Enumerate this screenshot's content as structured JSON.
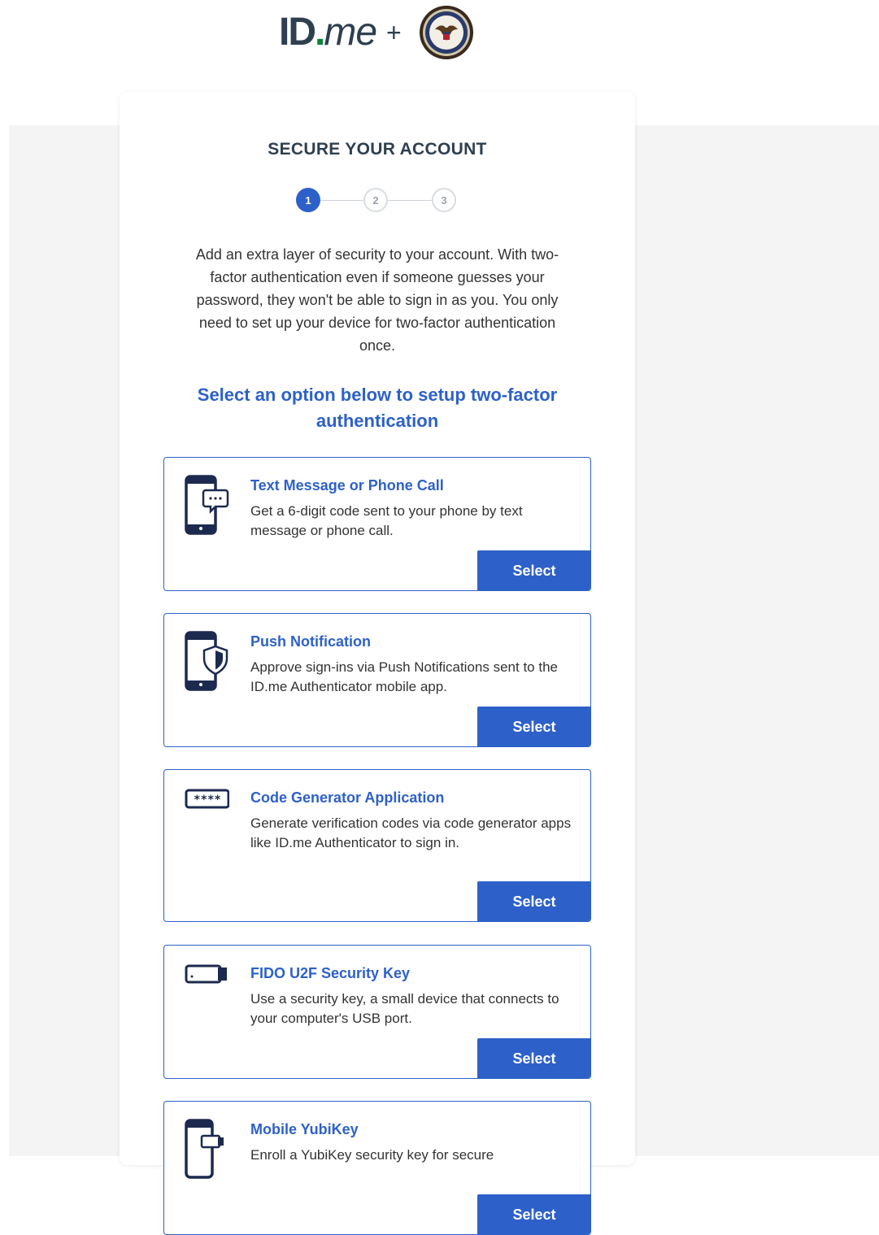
{
  "header": {
    "logo_id": "ID",
    "logo_dot": ".",
    "logo_me": "me",
    "plus": "+"
  },
  "card": {
    "title": "SECURE YOUR ACCOUNT",
    "steps": [
      "1",
      "2",
      "3"
    ],
    "active_step": 1,
    "intro": "Add an extra layer of security to your account. With two-factor authentication even if someone guesses your password, they won't be able to sign in as you. You only need to set up your device for two-factor authentication once.",
    "subhead": "Select an option below to setup two-factor authentication"
  },
  "options": [
    {
      "icon": "phone-message-icon",
      "title": "Text Message or Phone Call",
      "description": "Get a 6-digit code sent to your phone by text message or phone call.",
      "button": "Select"
    },
    {
      "icon": "phone-shield-icon",
      "title": "Push Notification",
      "description": "Approve sign-ins via Push Notifications sent to the ID.me Authenticator mobile app.",
      "button": "Select"
    },
    {
      "icon": "password-code-icon",
      "title": "Code Generator Application",
      "description": "Generate verification codes via code generator apps like ID.me Authenticator to sign in.",
      "button": "Select"
    },
    {
      "icon": "usb-key-icon",
      "title": "FIDO U2F Security Key",
      "description": "Use a security key, a small device that connects to your computer's USB port.",
      "button": "Select"
    },
    {
      "icon": "phone-usb-key-icon",
      "title": "Mobile YubiKey",
      "description": "Enroll a YubiKey security key for secure",
      "button": "Select"
    }
  ],
  "colors": {
    "accent": "#2d61c9",
    "logo_text": "#2e3f50",
    "logo_dot": "#08833d",
    "page_bg": "#f4f4f4"
  }
}
